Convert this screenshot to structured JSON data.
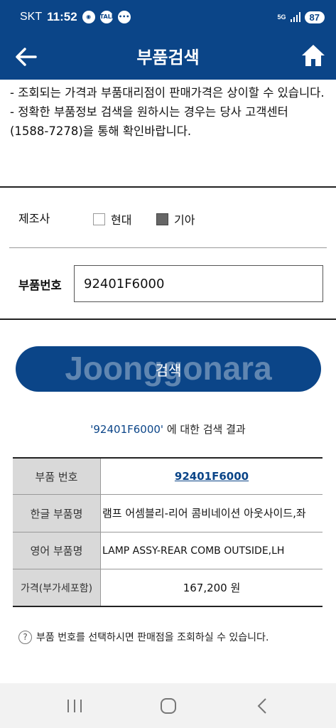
{
  "status_bar": {
    "carrier": "SKT",
    "time": "11:52",
    "net": "5G",
    "battery": "87"
  },
  "app_bar": {
    "title": "부품검색"
  },
  "notice": {
    "line1": "- 조회되는 가격과 부품대리점이 판매가격은 상이할 수 있습니다.",
    "line2": "- 정확한 부품정보 검색을 원하시는 경우는 당사 고객센터 (1588-7278)을 통해 확인바랍니다."
  },
  "form": {
    "maker_label": "제조사",
    "maker_options": [
      {
        "label": "현대",
        "checked": false
      },
      {
        "label": "기아",
        "checked": true
      }
    ],
    "part_label": "부품번호",
    "part_value": "92401F6000"
  },
  "search_button": {
    "label": "검색",
    "watermark": "Joonggonara"
  },
  "result": {
    "query": "'92401F6000'",
    "caption_suffix": " 에 대한 검색 결과",
    "rows": [
      {
        "header": "부품 번호",
        "value": "92401F6000"
      },
      {
        "header": "한글 부품명",
        "value": "램프 어셈블리-리어 콤비네이션 아웃사이드,좌"
      },
      {
        "header": "영어 부품명",
        "value": "LAMP ASSY-REAR COMB OUTSIDE,LH"
      },
      {
        "header": "가격(부가세포함)",
        "value": "167,200 원"
      }
    ]
  },
  "help_text": "부품 번호를 선택하시면 판매점을 조회하실 수 있습니다.",
  "colors": {
    "brand": "#0b4588",
    "table_header_bg": "#d9d9d9"
  }
}
